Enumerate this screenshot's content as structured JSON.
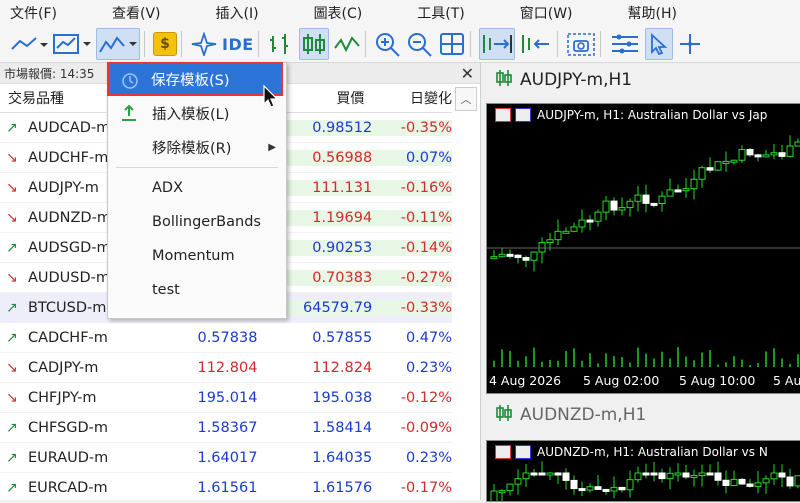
{
  "menubar": [
    "文件(F)",
    "查看(V)",
    "插入(I)",
    "圖表(C)",
    "工具(T)",
    "窗口(W)",
    "幫助(H)"
  ],
  "toolbar": {
    "ide_label": "IDE",
    "dollar_label": "$"
  },
  "market_watch": {
    "title": "市場報價: 14:35",
    "columns": {
      "symbol": "交易品種",
      "ask": "買價",
      "change": "日變化"
    },
    "rows": [
      {
        "dir": "up",
        "symbol": "AUDCAD-m",
        "bid": "",
        "ask": "0.98512",
        "change": "-0.35%",
        "ask_color": "blue"
      },
      {
        "dir": "down",
        "symbol": "AUDCHF-m",
        "bid": "",
        "ask": "0.56988",
        "change": "0.07%",
        "ask_color": "red"
      },
      {
        "dir": "down",
        "symbol": "AUDJPY-m",
        "bid": "",
        "ask": "111.131",
        "change": "-0.16%",
        "ask_color": "red"
      },
      {
        "dir": "down",
        "symbol": "AUDNZD-m",
        "bid": "",
        "ask": "1.19694",
        "change": "-0.11%",
        "ask_color": "red"
      },
      {
        "dir": "up",
        "symbol": "AUDSGD-m",
        "bid": "",
        "ask": "0.90253",
        "change": "-0.14%",
        "ask_color": "blue"
      },
      {
        "dir": "down",
        "symbol": "AUDUSD-m",
        "bid": "",
        "ask": "0.70383",
        "change": "-0.27%",
        "ask_color": "red"
      },
      {
        "dir": "up",
        "symbol": "BTCUSD-m",
        "bid": "",
        "ask": "64579.79",
        "change": "-0.33%",
        "ask_color": "blue"
      },
      {
        "dir": "up",
        "symbol": "CADCHF-m",
        "bid": "0.57838",
        "ask": "0.57855",
        "change": "0.47%",
        "ask_color": "blue"
      },
      {
        "dir": "down",
        "symbol": "CADJPY-m",
        "bid": "112.804",
        "ask": "112.824",
        "change": "0.23%",
        "ask_color": "red"
      },
      {
        "dir": "down",
        "symbol": "CHFJPY-m",
        "bid": "195.014",
        "ask": "195.038",
        "change": "-0.12%",
        "ask_color": "blue"
      },
      {
        "dir": "up",
        "symbol": "CHFSGD-m",
        "bid": "1.58367",
        "ask": "1.58414",
        "change": "-0.09%",
        "ask_color": "blue"
      },
      {
        "dir": "up",
        "symbol": "EURAUD-m",
        "bid": "1.64017",
        "ask": "1.64035",
        "change": "0.23%",
        "ask_color": "blue"
      },
      {
        "dir": "up",
        "symbol": "EURCAD-m",
        "bid": "1.61561",
        "ask": "1.61576",
        "change": "-0.17%",
        "ask_color": "blue"
      }
    ]
  },
  "context_menu": {
    "items": [
      {
        "label": "保存模板(S)",
        "icon": "save-template-icon"
      },
      {
        "label": "插入模板(L)",
        "icon": "insert-template-icon"
      },
      {
        "label": "移除模板(R)",
        "icon": ""
      }
    ],
    "templates": [
      "ADX",
      "BollingerBands",
      "Momentum",
      "test"
    ]
  },
  "charts": [
    {
      "title": "AUDJPY-m,H1",
      "header": "AUDJPY-m, H1:  Australian Dollar vs Jap",
      "ticks": [
        "4 Aug 2026",
        "5 Aug 02:00",
        "5 Aug 10:00",
        "5 Au"
      ]
    },
    {
      "title": "AUDNZD-m,H1",
      "header": "AUDNZD-m, H1:  Australian Dollar vs N"
    }
  ],
  "colors": {
    "accent": "#2d74d8",
    "up": "#1e8a3a",
    "down": "#d03030",
    "ask_blue": "#1a3bd0",
    "ask_red": "#d02a2a"
  }
}
